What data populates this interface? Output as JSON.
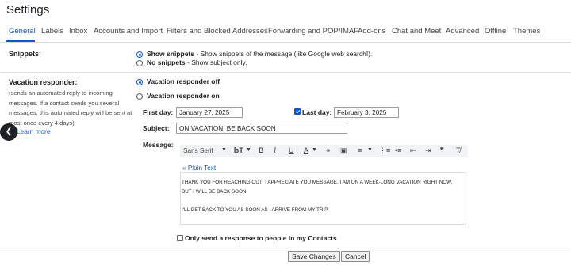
{
  "page": {
    "title": "Settings"
  },
  "tabs": [
    "General",
    "Labels",
    "Inbox",
    "Accounts and Import",
    "Filters and Blocked Addresses",
    "Forwarding and POP/IMAP",
    "Add-ons",
    "Chat and Meet",
    "Advanced",
    "Offline",
    "Themes"
  ],
  "active_tab": "General",
  "snippets": {
    "label": "Snippets:",
    "show_bold": "Show snippets",
    "show_rest": " - Show snippets of the message (like Google web search!).",
    "none_bold": "No snippets",
    "none_rest": " - Show subject only.",
    "selected": "show"
  },
  "vacation": {
    "label": "Vacation responder:",
    "description": "(sends an automated reply to incoming messages. If a contact sends you several messages, this automated reply will be sent at most once every 4 days)",
    "learn_more": "Learn more",
    "off_label": "Vacation responder off",
    "on_label": "Vacation responder on",
    "selected": "off",
    "first_day_label": "First day:",
    "first_day": "January 27, 2025",
    "last_day_label": "Last day:",
    "last_day": "February 3, 2025",
    "last_day_checked": true,
    "subject_label": "Subject:",
    "subject": "ON VACATION, BE BACK SOON",
    "message_label": "Message:",
    "font_family": "Sans Serif",
    "plain_text_link": "« Plain Text",
    "message_line_1": "THANK YOU FOR REACHING OUT! I APPRECIATE YOU MESSAGE. I AM ON A WEEK-LONG VACATION RIGHT NOW, BUT I WILL BE BACK SOON.",
    "message_line_2": "I'LL GET BACK TO YOU AS SOON AS I ARRIVE FROM MY TRIP.",
    "contacts_only_label": "Only send a response to people in my Contacts",
    "contacts_only_checked": false
  },
  "buttons": {
    "save": "Save Changes",
    "cancel": "Cancel"
  },
  "colors": {
    "accent": "#0b57d0",
    "text": "#202124",
    "muted": "#444746"
  }
}
